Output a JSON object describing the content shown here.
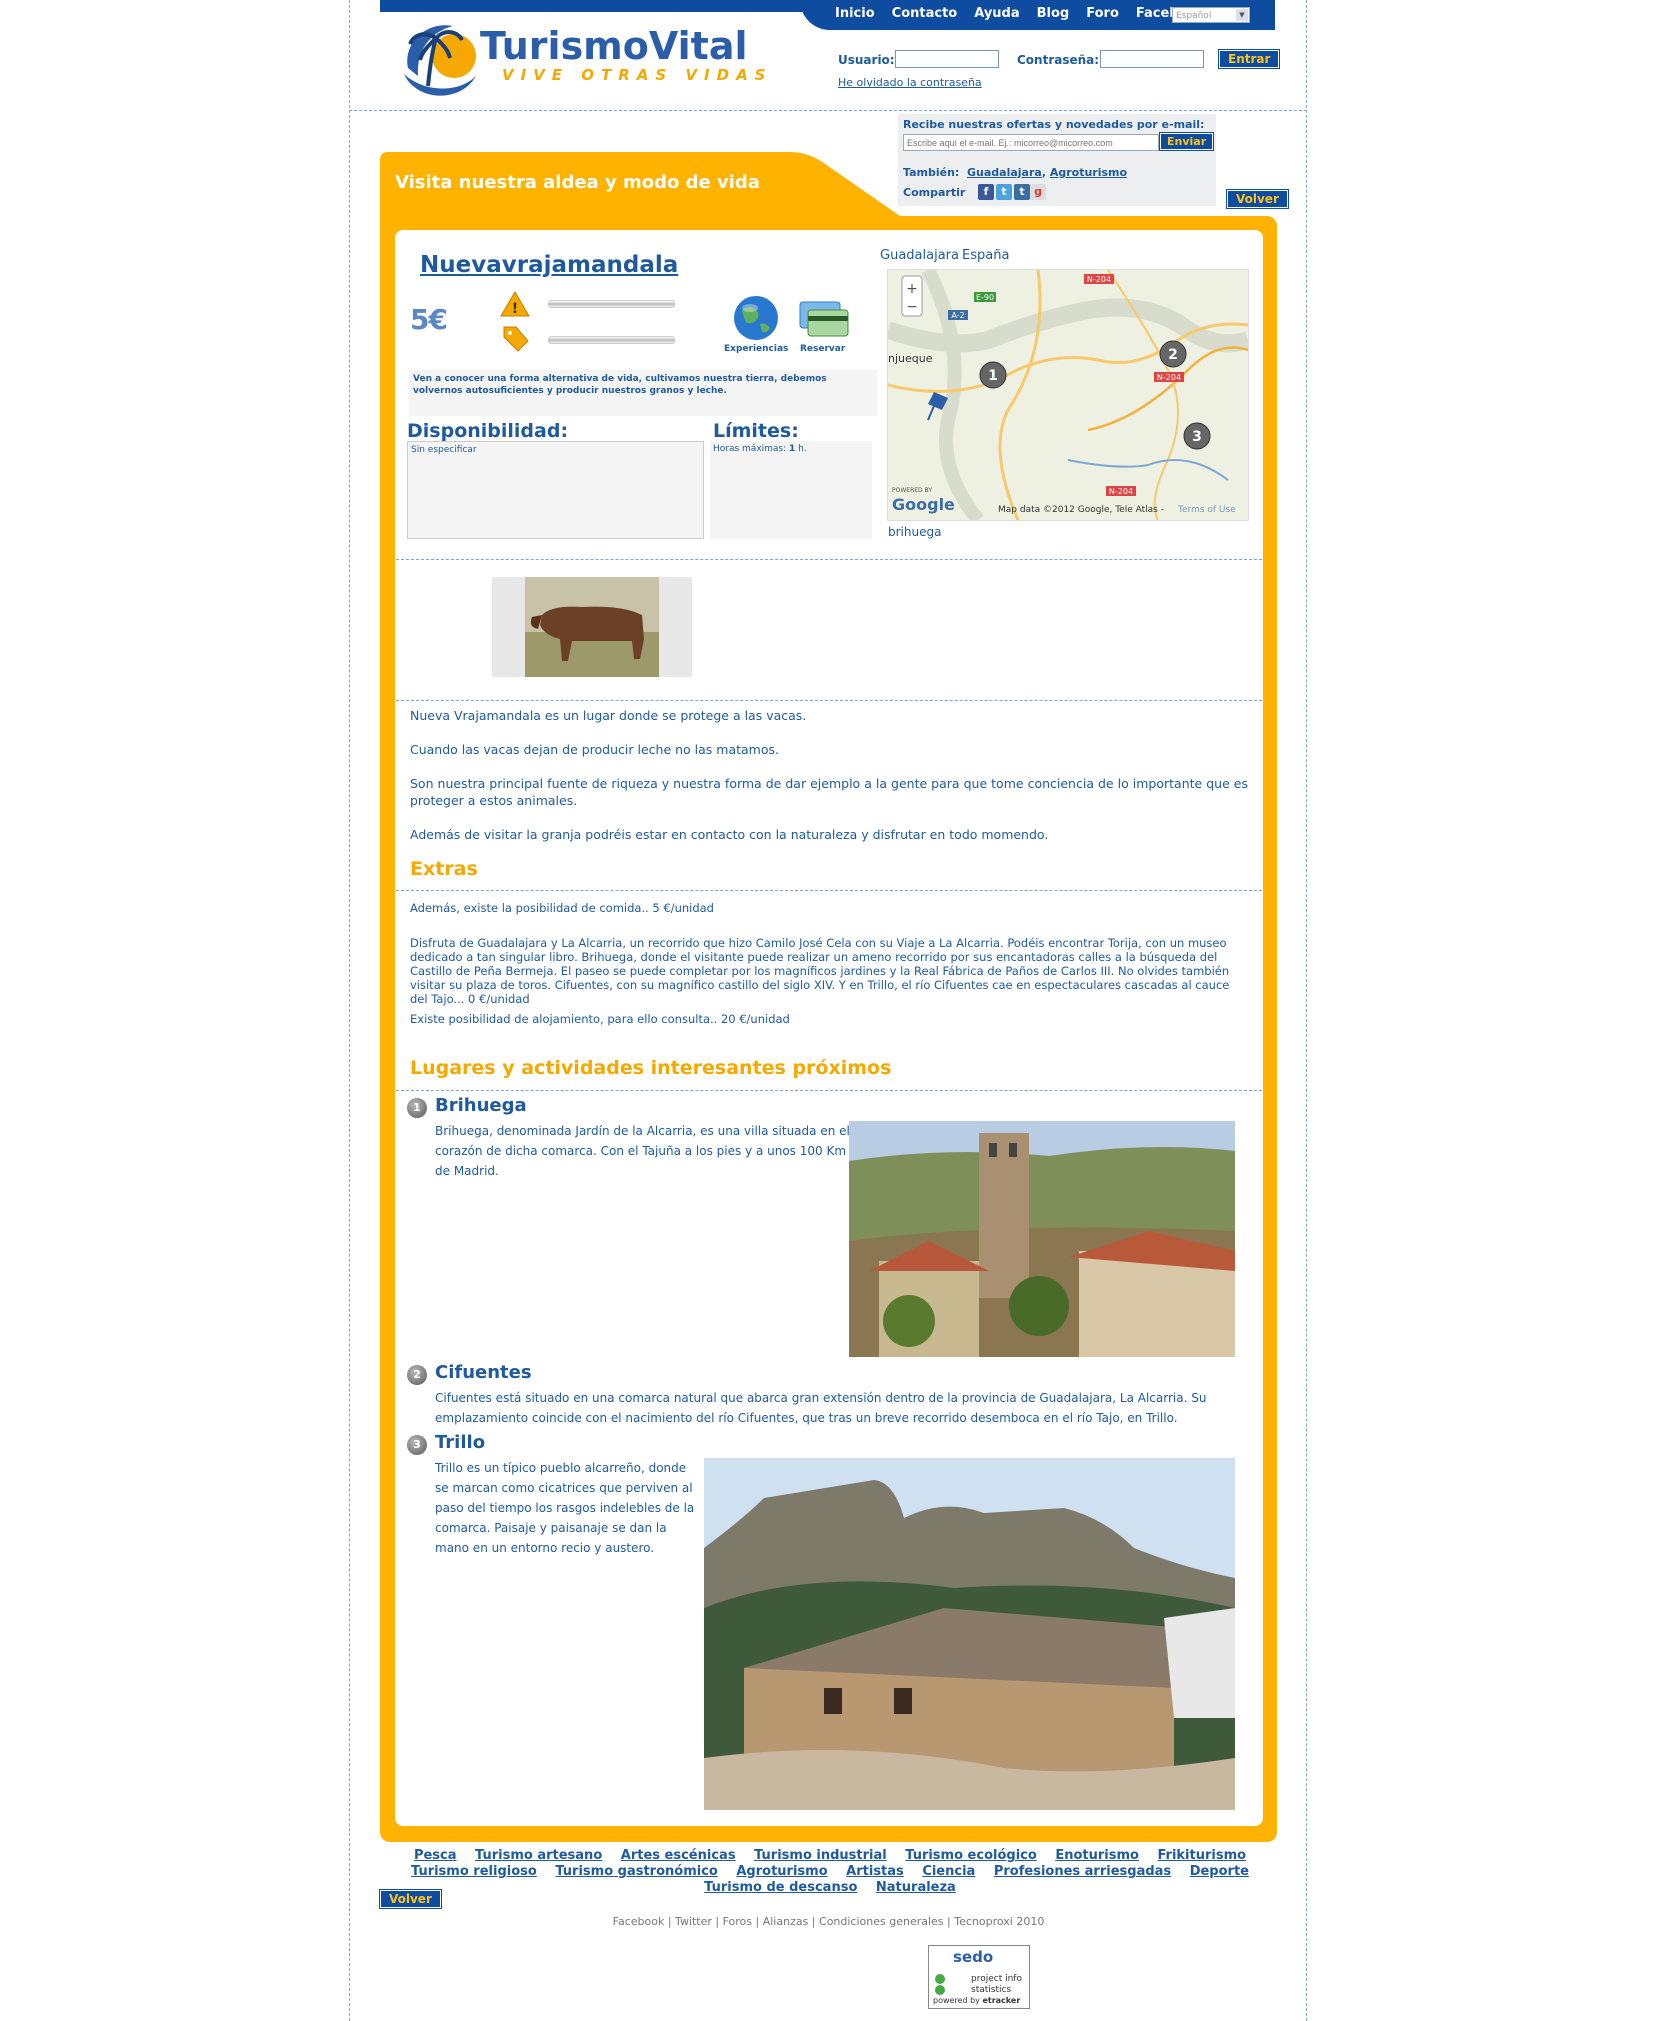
{
  "nav": {
    "links": [
      "Inicio",
      "Contacto",
      "Ayuda",
      "Blog",
      "Foro",
      "Facebook"
    ],
    "language": "Español"
  },
  "logo": {
    "name_part1": "Turismo",
    "name_part2": "Vital",
    "tagline": "VIVE OTRAS VIDAS"
  },
  "login": {
    "user_label": "Usuario:",
    "pass_label": "Contraseña:",
    "submit": "Entrar",
    "forgot": "He olvidado la contraseña"
  },
  "newsletter": {
    "title": "Recibe nuestras ofertas y novedades por e-mail:",
    "placeholder": "Escribe aquí el e-mail. Ej.: micorreo@micorreo.com",
    "submit": "Enviar",
    "also_label": "También:",
    "also_links": [
      "Guadalajara",
      "Agroturismo"
    ],
    "share_label": "Compartir"
  },
  "back_button": "Volver",
  "section_title": "Visita nuestra aldea y modo de vida",
  "listing": {
    "title": "Nuevavrajamandala",
    "price": "5€",
    "icon_experiences": "Experiencias",
    "icon_book": "Reservar",
    "description": "Ven a conocer una forma alternativa de vida, cultivamos nuestra tierra, debemos volvernos autosuficientes y producir nuestros granos y leche.",
    "availability_title": "Disponibilidad:",
    "availability_value": "Sin especificar",
    "limits_title": "Límites:",
    "limits_label": "Horas máximas:",
    "limits_value": "1",
    "limits_unit": "h."
  },
  "location": {
    "province": "Guadalajara",
    "country": "España",
    "map_caption": "brihuega",
    "map_credit": "Map data ©2012 Google, Tele Atlas -",
    "map_terms": "Terms of Use",
    "map_powered": "POWERED BY",
    "map_google": "Google",
    "map_town_left": "njueque",
    "map_roads": [
      "N-204",
      "E-90",
      "A-2",
      "N-204",
      "N-204"
    ],
    "markers": [
      "1",
      "2",
      "3"
    ]
  },
  "body_paragraphs": [
    "Nueva Vrajamandala es un lugar donde se protege a las vacas.",
    "Cuando las vacas dejan de producir leche no las matamos.",
    "Son nuestra principal fuente de riqueza y nuestra forma de dar ejemplo a la gente para que tome conciencia de lo importante que es proteger a estos animales.",
    "Además de visitar la granja podréis estar en contacto con la naturaleza y disfrutar en todo momendo."
  ],
  "extras": {
    "title": "Extras",
    "items": [
      "Además, existe la posibilidad de comida.. 5 €/unidad",
      "Disfruta de Guadalajara y La Alcarria, un recorrido que hizo Camilo José Cela con su Viaje a La Alcarria. Podéis encontrar Torija, con un museo dedicado a tan singular libro. Brihuega, donde el visitante puede realizar un ameno recorrido por sus encantadoras calles a la búsqueda del Castillo de Peña Bermeja. El paseo se puede completar por los magníficos jardines y la Real Fábrica de Paños de Carlos III. No olvides también visitar su plaza de toros. Cifuentes, con su magnífico castillo del siglo XIV. Y en Trillo, el río Cifuentes cae en espectaculares cascadas al cauce del Tajo... 0 €/unidad",
      "Existe posibilidad de alojamiento, para ello consulta.. 20 €/unidad"
    ]
  },
  "places": {
    "title": "Lugares y actividades interesantes próximos",
    "items": [
      {
        "num": "1",
        "name": "Brihuega",
        "text": "Brihuega, denominada Jardín de la Alcarria, es una villa situada en el corazón de dicha comarca. Con el Tajuña a los pies y a unos 100 Km de Madrid."
      },
      {
        "num": "2",
        "name": "Cifuentes",
        "text": "Cifuentes está situado en una comarca natural que abarca gran extensión dentro de la provincia de Guadalajara, La Alcarria. Su emplazamiento coincide con el nacimiento del río Cifuentes, que tras un breve recorrido desemboca en el río Tajo, en Trillo."
      },
      {
        "num": "3",
        "name": "Trillo",
        "text": "Trillo es un típico pueblo alcarreño, donde se marcan como cicatrices que perviven al paso del tiempo los rasgos indelebles de la comarca. Paisaje y paisanaje se dan la mano en un entorno recio y austero."
      }
    ]
  },
  "footer": {
    "categories": [
      "Pesca",
      "Turismo artesano",
      "Artes escénicas",
      "Turismo industrial",
      "Turismo ecológico",
      "Enoturismo",
      "Frikiturismo",
      "Turismo religioso",
      "Turismo gastronómico",
      "Agroturismo",
      "Artistas",
      "Ciencia",
      "Profesiones arriesgadas",
      "Deporte",
      "Turismo de descanso",
      "Naturaleza"
    ],
    "copyright": "Facebook | Twitter | Foros | Alianzas | Condiciones generales | Tecnoproxi 2010",
    "sedo_title": "sedo",
    "sedo_line1": "project info",
    "sedo_line2": "statistics",
    "sedo_line3": "powered by",
    "sedo_line4": "etracker"
  },
  "colors": {
    "brand_blue": "#0d4c9e",
    "brand_orange": "#ffb300",
    "text_blue": "#1e5a9c"
  }
}
